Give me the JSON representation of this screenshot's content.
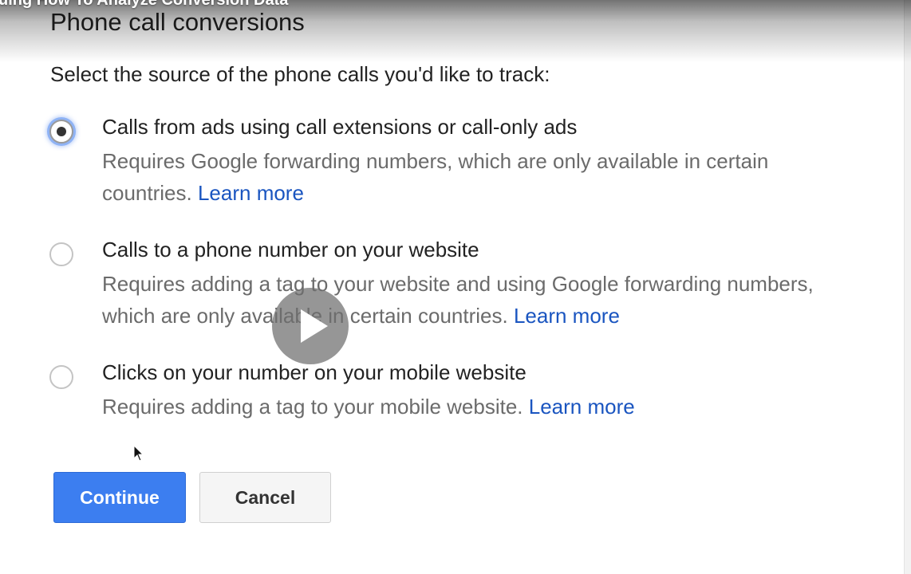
{
  "video": {
    "title_fragment": "uing How To Analyze Conversion Data"
  },
  "dialog": {
    "title": "Phone call conversions",
    "prompt": "Select the source of the phone calls you'd like to track:",
    "options": [
      {
        "title": "Calls from ads using call extensions or call-only ads",
        "description": "Requires Google forwarding numbers, which are only available in certain countries.",
        "link": "Learn more",
        "selected": true
      },
      {
        "title": "Calls to a phone number on your website",
        "description": "Requires adding a tag to your website and using Google forwarding numbers, which are only available in certain countries.",
        "link": "Learn more",
        "selected": false
      },
      {
        "title": "Clicks on your number on your mobile website",
        "description": "Requires adding a tag to your mobile website.",
        "link": "Learn more",
        "selected": false
      }
    ],
    "continue_label": "Continue",
    "cancel_label": "Cancel"
  },
  "icons": {
    "play": "play-icon",
    "cursor": "mouse-pointer-icon",
    "radio_selected": "radio-selected",
    "radio_unselected": "radio-unselected"
  },
  "colors": {
    "link": "#1a55c0",
    "primary_button": "#3c7ef0",
    "focus_ring": "#8fb3f5",
    "description_text": "#6b6b6b"
  }
}
